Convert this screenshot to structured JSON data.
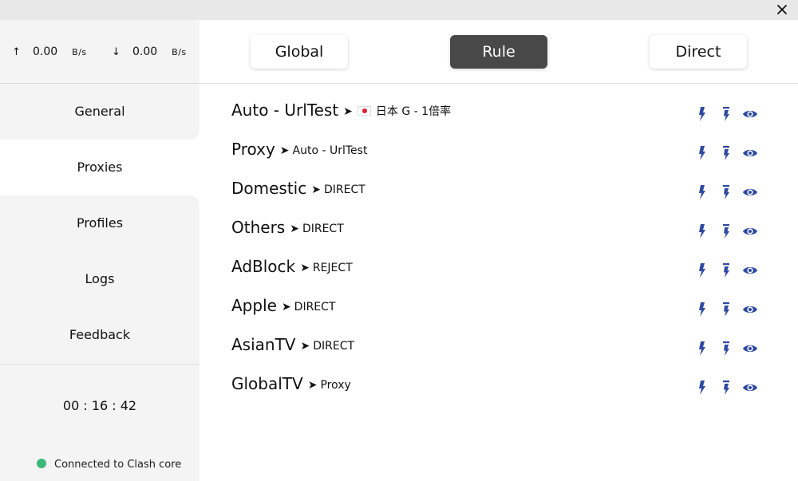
{
  "window": {
    "close_icon": "close-icon"
  },
  "traffic": {
    "up_arrow": "↑",
    "up_value": "0.00",
    "up_unit": "B/s",
    "down_arrow": "↓",
    "down_value": "0.00",
    "down_unit": "B/s"
  },
  "nav": {
    "items": [
      {
        "label": "General"
      },
      {
        "label": "Proxies"
      },
      {
        "label": "Profiles"
      },
      {
        "label": "Logs"
      },
      {
        "label": "Feedback"
      }
    ],
    "active": "Proxies"
  },
  "footer": {
    "timer": "00 : 16 : 42",
    "status": "Connected to Clash core",
    "status_color": "#3cb878"
  },
  "modes": {
    "global": "Global",
    "rule": "Rule",
    "direct": "Direct",
    "active": "Rule",
    "active_color": "#484848"
  },
  "proxies": [
    {
      "name": "Auto - UrlTest",
      "arrow": "➤",
      "selected": "日本 G - 1倍率",
      "flag": "japan-flag-icon"
    },
    {
      "name": "Proxy",
      "arrow": "➤",
      "selected": "Auto - UrlTest"
    },
    {
      "name": "Domestic",
      "arrow": "➤",
      "selected": "DIRECT"
    },
    {
      "name": "Others",
      "arrow": "➤",
      "selected": "DIRECT"
    },
    {
      "name": "AdBlock",
      "arrow": "➤",
      "selected": "REJECT"
    },
    {
      "name": "Apple",
      "arrow": "➤",
      "selected": "DIRECT"
    },
    {
      "name": "AsianTV",
      "arrow": "➤",
      "selected": "DIRECT"
    },
    {
      "name": "GlobalTV",
      "arrow": "➤",
      "selected": "Proxy"
    }
  ],
  "icon_color": "#2f4aa0"
}
